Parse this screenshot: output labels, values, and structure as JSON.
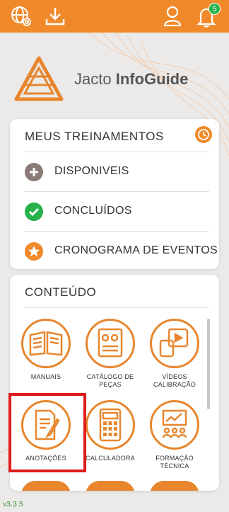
{
  "topbar": {
    "color": "#f0892a",
    "icons": [
      "globe-settings-icon",
      "download-icon",
      "user-icon",
      "bell-icon"
    ],
    "notification_count": "5"
  },
  "brand": {
    "name_light": "Jacto ",
    "name_bold": "InfoGuide"
  },
  "treinamentos": {
    "title": "MEUS TREINAMENTOS",
    "items": [
      {
        "label": "DISPONIVEIS",
        "icon": "plus-circle-icon",
        "color": "#8a7a78"
      },
      {
        "label": "CONCLUÍDOS",
        "icon": "check-circle-icon",
        "color": "#27b24a"
      },
      {
        "label": "CRONOGRAMA DE EVENTOS",
        "icon": "star-circle-icon",
        "color": "#f0892a"
      }
    ]
  },
  "conteudo": {
    "title": "CONTEÚDO",
    "tiles": [
      {
        "line1": "MANUAIS",
        "line2": ""
      },
      {
        "line1": "CATÁLOGO DE",
        "line2": "PEÇAS"
      },
      {
        "line1": "VÍDEOS",
        "line2": "CALIBRAÇÃO"
      },
      {
        "line1": "ANOTAÇÕES",
        "line2": ""
      },
      {
        "line1": "CALCULADORA",
        "line2": ""
      },
      {
        "line1": "FORMAÇÃO",
        "line2": "TÉCNICA"
      }
    ]
  },
  "version": "v3.3.5",
  "accent": "#e8862e",
  "highlight_color": "#e01b1b"
}
